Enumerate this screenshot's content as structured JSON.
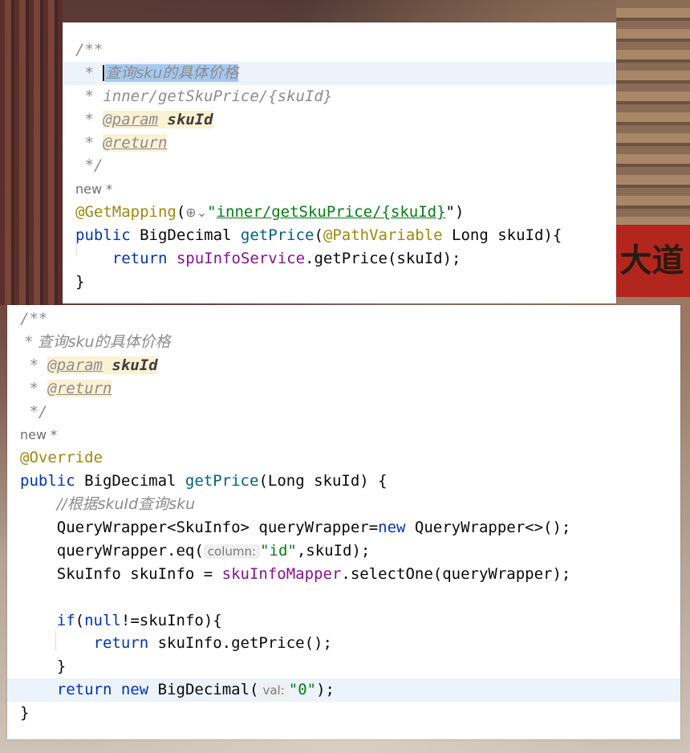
{
  "background": {
    "sign_text": "大道谷"
  },
  "panel1": {
    "doc": {
      "open": "/**",
      "line1_star": " * ",
      "line1_text": "查询sku的具体价格",
      "line2": " * inner/getSkuPrice/{skuId}",
      "line3_star": " * ",
      "param_tag": "@param",
      "param_name": "skuId",
      "line4_star": " * ",
      "return_tag": "@return",
      "close": " */"
    },
    "new_marker": "new *",
    "mapping_annotation": "@GetMapping",
    "mapping_open": "(",
    "globe_icon": "⊕⌄",
    "mapping_quote_open": "\"",
    "mapping_url": "inner/getSkuPrice/{skuId}",
    "mapping_close": "\")",
    "sig_public": "public",
    "sig_type": " BigDecimal ",
    "sig_method": "getPrice",
    "sig_paren": "(",
    "sig_path_var": "@PathVariable",
    "sig_params": " Long skuId){",
    "ret_kw": "return",
    "ret_field": "spuInfoService",
    "ret_rest": ".getPrice(skuId);",
    "close_brace": "}"
  },
  "panel2": {
    "doc": {
      "open": "/**",
      "line1": " * 查询sku的具体价格",
      "line2_star": " * ",
      "param_tag": "@param",
      "param_name": "skuId",
      "line3_star": " * ",
      "return_tag": "@return",
      "close": " */"
    },
    "new_marker": "new *",
    "override": "@Override",
    "sig_public": "public",
    "sig_type": " BigDecimal ",
    "sig_method": "getPrice",
    "sig_rest": "(Long skuId) {",
    "comment": "//根据skuId查询sku",
    "qw_decl": "QueryWrapper<SkuInfo> queryWrapper=",
    "qw_new": "new",
    "qw_ctor": " QueryWrapper<>();",
    "eq_call": "queryWrapper.eq(",
    "eq_hint": "column:",
    "eq_str": "\"id\"",
    "eq_rest": ",skuId);",
    "sel_decl": "SkuInfo skuInfo = ",
    "sel_field": "skuInfoMapper",
    "sel_rest": ".selectOne(queryWrapper);",
    "if_kw": "if",
    "if_open": "(",
    "if_null": "null",
    "if_rest": "!=skuInfo){",
    "inner_ret_kw": "return",
    "inner_ret_rest": " skuInfo.getPrice();",
    "if_close": "}",
    "ret_kw": "return",
    "ret_new": "new",
    "ret_type": " BigDecimal(",
    "ret_hint": "val:",
    "ret_str": "\"0\"",
    "ret_end": ");",
    "close_brace": "}"
  }
}
